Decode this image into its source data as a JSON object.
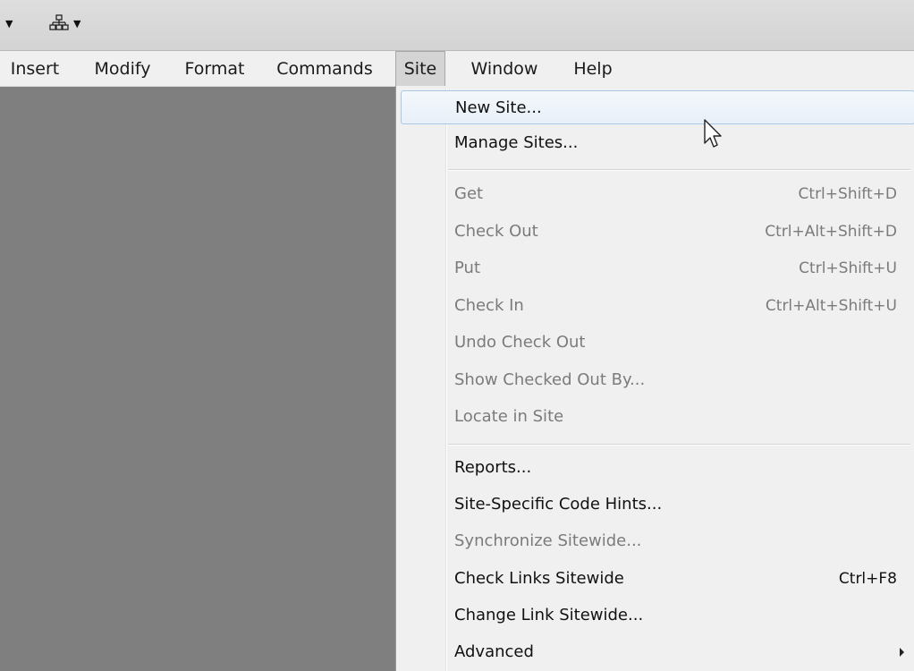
{
  "menubar": {
    "items": [
      {
        "label": "Insert"
      },
      {
        "label": "Modify"
      },
      {
        "label": "Format"
      },
      {
        "label": "Commands"
      },
      {
        "label": "Site"
      },
      {
        "label": "Window"
      },
      {
        "label": "Help"
      }
    ],
    "active": "Site"
  },
  "site_menu": {
    "items": [
      {
        "label": "New Site...",
        "shortcut": "",
        "enabled": true,
        "highlighted": true
      },
      {
        "label": "Manage Sites...",
        "shortcut": "",
        "enabled": true
      },
      {
        "label": "Get",
        "shortcut": "Ctrl+Shift+D",
        "enabled": false
      },
      {
        "label": "Check Out",
        "shortcut": "Ctrl+Alt+Shift+D",
        "enabled": false
      },
      {
        "label": "Put",
        "shortcut": "Ctrl+Shift+U",
        "enabled": false
      },
      {
        "label": "Check In",
        "shortcut": "Ctrl+Alt+Shift+U",
        "enabled": false
      },
      {
        "label": "Undo Check Out",
        "shortcut": "",
        "enabled": false
      },
      {
        "label": "Show Checked Out By...",
        "shortcut": "",
        "enabled": false
      },
      {
        "label": "Locate in Site",
        "shortcut": "",
        "enabled": false
      },
      {
        "label": "Reports...",
        "shortcut": "",
        "enabled": true
      },
      {
        "label": "Site-Specific Code Hints...",
        "shortcut": "",
        "enabled": true
      },
      {
        "label": "Synchronize Sitewide...",
        "shortcut": "",
        "enabled": false
      },
      {
        "label": "Check Links Sitewide",
        "shortcut": "Ctrl+F8",
        "enabled": true
      },
      {
        "label": "Change Link Sitewide...",
        "shortcut": "",
        "enabled": true
      },
      {
        "label": "Advanced",
        "shortcut": "",
        "enabled": true,
        "submenu": true
      }
    ]
  },
  "icons": {
    "toolbar_caret": "caret-down-icon",
    "toolbar_sitemap": "site-map-icon",
    "submenu_arrow": "chevron-right-icon",
    "cursor": "mouse-pointer-icon"
  },
  "colors": {
    "workspace": "#7f7f7f",
    "menu_bg": "#f0f0f0",
    "highlight_border": "#a9c7e6",
    "disabled_text": "#7b7b7b"
  }
}
